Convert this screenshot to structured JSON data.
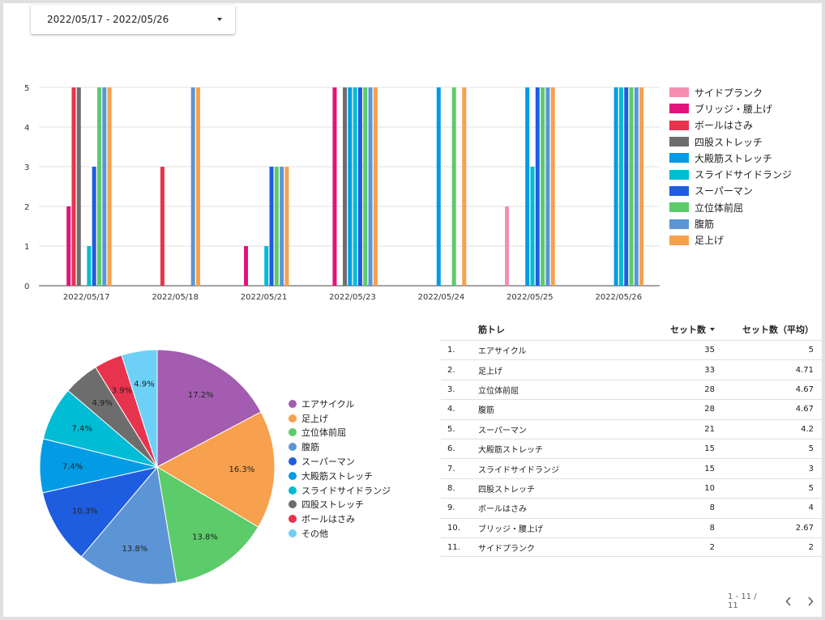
{
  "date_range": {
    "label": "2022/05/17 - 2022/05/26"
  },
  "colors": {
    "サイドプランク": "#f48fb1",
    "ブリッジ・腰上げ": "#e3127d",
    "ボールはさみ": "#e8334e",
    "四股ストレッチ": "#6d6d6d",
    "大殿筋ストレッチ": "#039be5",
    "スライドサイドランジ": "#00bcd4",
    "スーパーマン": "#1e5de0",
    "立位体前屈": "#5ccb6a",
    "腹筋": "#5b95d6",
    "足上げ": "#f7a04d",
    "エアサイクル": "#a35cb0",
    "その他": "#6dd1f7"
  },
  "chart_data": [
    {
      "type": "bar",
      "categories": [
        "2022/05/17",
        "2022/05/18",
        "2022/05/21",
        "2022/05/23",
        "2022/05/24",
        "2022/05/25",
        "2022/05/26"
      ],
      "ylim": [
        0,
        5
      ],
      "yticks": [
        0,
        1,
        2,
        3,
        4,
        5
      ],
      "grid": true,
      "legend": "right",
      "series": [
        {
          "name": "サイドプランク",
          "values": [
            0,
            0,
            0,
            0,
            0,
            2,
            0
          ]
        },
        {
          "name": "ブリッジ・腰上げ",
          "values": [
            2,
            0,
            1,
            5,
            0,
            0,
            0
          ]
        },
        {
          "name": "ボールはさみ",
          "values": [
            5,
            3,
            0,
            0,
            0,
            0,
            0
          ]
        },
        {
          "name": "四股ストレッチ",
          "values": [
            5,
            0,
            0,
            5,
            0,
            0,
            0
          ]
        },
        {
          "name": "大殿筋ストレッチ",
          "values": [
            0,
            0,
            0,
            5,
            5,
            5,
            5
          ]
        },
        {
          "name": "スライドサイドランジ",
          "values": [
            1,
            0,
            1,
            5,
            0,
            3,
            5
          ]
        },
        {
          "name": "スーパーマン",
          "values": [
            3,
            0,
            3,
            5,
            0,
            5,
            5
          ]
        },
        {
          "name": "立位体前屈",
          "values": [
            5,
            0,
            3,
            5,
            5,
            5,
            5
          ]
        },
        {
          "name": "腹筋",
          "values": [
            5,
            5,
            3,
            5,
            0,
            5,
            5
          ]
        },
        {
          "name": "足上げ",
          "values": [
            5,
            5,
            3,
            5,
            5,
            5,
            5
          ]
        }
      ]
    },
    {
      "type": "pie",
      "legend": "right",
      "slices": [
        {
          "label": "エアサイクル",
          "percent": 17.2,
          "display": "17.2%"
        },
        {
          "label": "足上げ",
          "percent": 16.3,
          "display": "16.3%"
        },
        {
          "label": "立位体前屈",
          "percent": 13.8,
          "display": "13.8%"
        },
        {
          "label": "腹筋",
          "percent": 13.8,
          "display": "13.8%"
        },
        {
          "label": "スーパーマン",
          "percent": 10.3,
          "display": "10.3%"
        },
        {
          "label": "大殿筋ストレッチ",
          "percent": 7.4,
          "display": "7.4%"
        },
        {
          "label": "スライドサイドランジ",
          "percent": 7.4,
          "display": "7.4%"
        },
        {
          "label": "四股ストレッチ",
          "percent": 4.9,
          "display": "4.9%"
        },
        {
          "label": "ボールはさみ",
          "percent": 3.9,
          "display": "3.9%"
        },
        {
          "label": "その他",
          "percent": 4.9,
          "display": "4.9%"
        }
      ]
    },
    {
      "type": "table",
      "columns": [
        "筋トレ",
        "セット数",
        "セット数（平均）"
      ],
      "sorted_by": "セット数",
      "rows": [
        {
          "no": "1.",
          "name": "エアサイクル",
          "sets": "35",
          "avg": "5"
        },
        {
          "no": "2.",
          "name": "足上げ",
          "sets": "33",
          "avg": "4.71"
        },
        {
          "no": "3.",
          "name": "立位体前屈",
          "sets": "28",
          "avg": "4.67"
        },
        {
          "no": "4.",
          "name": "腹筋",
          "sets": "28",
          "avg": "4.67"
        },
        {
          "no": "5.",
          "name": "スーパーマン",
          "sets": "21",
          "avg": "4.2"
        },
        {
          "no": "6.",
          "name": "大殿筋ストレッチ",
          "sets": "15",
          "avg": "5"
        },
        {
          "no": "7.",
          "name": "スライドサイドランジ",
          "sets": "15",
          "avg": "3"
        },
        {
          "no": "8.",
          "name": "四股ストレッチ",
          "sets": "10",
          "avg": "5"
        },
        {
          "no": "9.",
          "name": "ボールはさみ",
          "sets": "8",
          "avg": "4"
        },
        {
          "no": "10.",
          "name": "ブリッジ・腰上げ",
          "sets": "8",
          "avg": "2.67"
        },
        {
          "no": "11.",
          "name": "サイドプランク",
          "sets": "2",
          "avg": "2"
        }
      ]
    }
  ],
  "pagination": {
    "label": "1 - 11 / 11"
  }
}
